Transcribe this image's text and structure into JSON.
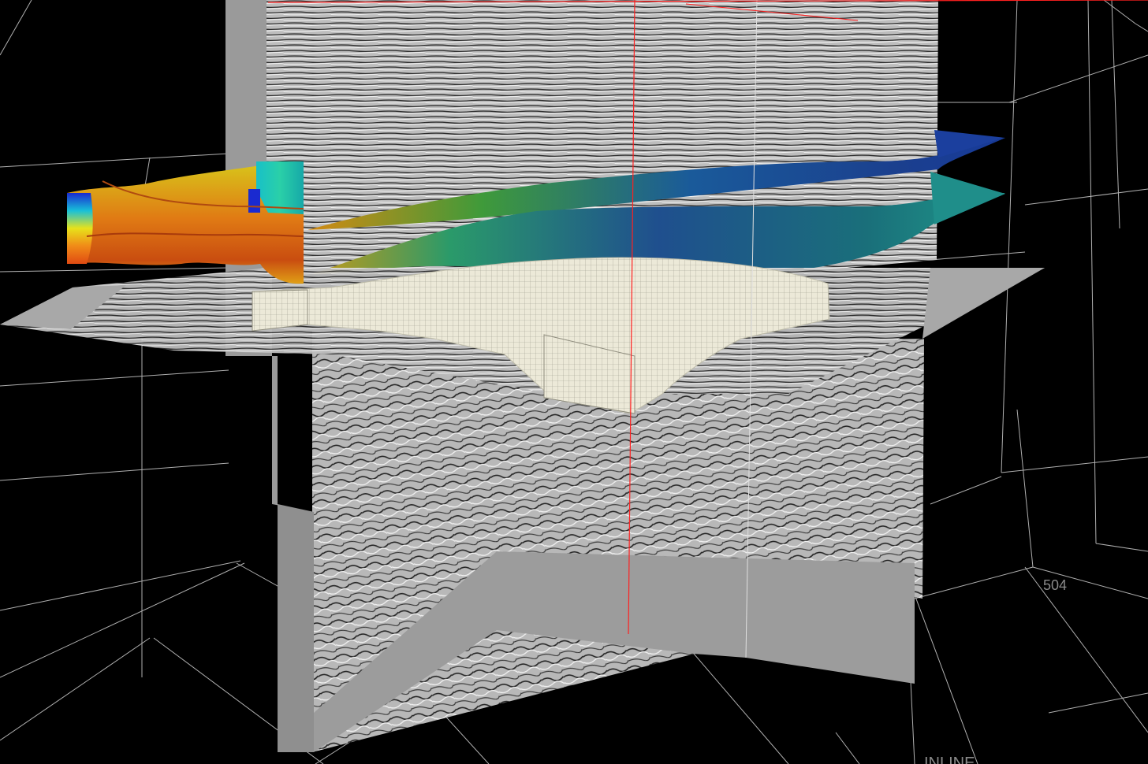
{
  "viewport": {
    "inline_axis_title": "INLINE",
    "tick_value": "504"
  },
  "colors": {
    "background": "#000000",
    "grid_line": "#d8d8d8",
    "section_gray": "#9c9c9c",
    "seismic_light": "#c8c8c8",
    "seismic_dark": "#3a3a3a",
    "cursor_line": "#ff2020",
    "grid_block": "#ece9d8",
    "horizon_blue": "#1a4fa8",
    "horizon_green": "#1f9a7a",
    "body_orange": "#e06a12",
    "body_yellow": "#d8b81a"
  }
}
